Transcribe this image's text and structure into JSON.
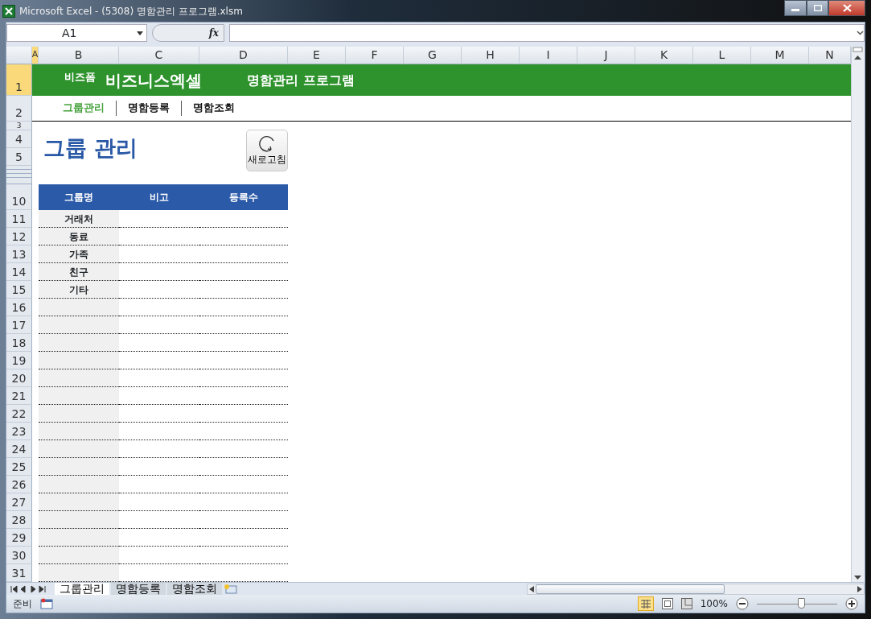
{
  "window": {
    "title": "Microsoft Excel - (5308) 명함관리 프로그램.xlsm"
  },
  "formula_bar": {
    "name_box": "A1",
    "fx": "fx"
  },
  "columns": [
    {
      "label": "A",
      "selected": true
    },
    {
      "label": "B",
      "selected": false
    },
    {
      "label": "C",
      "selected": false
    },
    {
      "label": "D",
      "selected": false
    },
    {
      "label": "E",
      "selected": false
    },
    {
      "label": "F",
      "selected": false
    },
    {
      "label": "G",
      "selected": false
    },
    {
      "label": "H",
      "selected": false
    },
    {
      "label": "I",
      "selected": false
    },
    {
      "label": "J",
      "selected": false
    },
    {
      "label": "K",
      "selected": false
    },
    {
      "label": "L",
      "selected": false
    },
    {
      "label": "M",
      "selected": false
    },
    {
      "label": "N",
      "selected": false
    }
  ],
  "row_headers": [
    {
      "label": "1",
      "selected": true
    },
    {
      "label": "2",
      "selected": false
    },
    {
      "label": "3",
      "selected": false
    },
    {
      "label": "4",
      "selected": false
    },
    {
      "label": "5",
      "selected": false
    },
    {
      "label": "10",
      "selected": false
    },
    {
      "label": "11",
      "selected": false
    },
    {
      "label": "12",
      "selected": false
    },
    {
      "label": "13",
      "selected": false
    },
    {
      "label": "14",
      "selected": false
    },
    {
      "label": "15",
      "selected": false
    },
    {
      "label": "16",
      "selected": false
    },
    {
      "label": "17",
      "selected": false
    },
    {
      "label": "18",
      "selected": false
    },
    {
      "label": "19",
      "selected": false
    },
    {
      "label": "20",
      "selected": false
    },
    {
      "label": "21",
      "selected": false
    },
    {
      "label": "22",
      "selected": false
    },
    {
      "label": "23",
      "selected": false
    },
    {
      "label": "24",
      "selected": false
    },
    {
      "label": "25",
      "selected": false
    },
    {
      "label": "26",
      "selected": false
    },
    {
      "label": "27",
      "selected": false
    },
    {
      "label": "28",
      "selected": false
    },
    {
      "label": "29",
      "selected": false
    },
    {
      "label": "30",
      "selected": false
    },
    {
      "label": "31",
      "selected": false
    }
  ],
  "banner": {
    "brand_small": "비즈폼",
    "brand": "비즈니스엑셀",
    "title": "명함관리 프로그램"
  },
  "nav": [
    {
      "label": "그룹관리",
      "selected": true
    },
    {
      "label": "명함등록",
      "selected": false
    },
    {
      "label": "명함조회",
      "selected": false
    }
  ],
  "page_title": "그룹 관리",
  "refresh_button": "새로고침",
  "table": {
    "columns": [
      "그룹명",
      "비고",
      "등록수"
    ],
    "rows": [
      {
        "group": "거래처"
      },
      {
        "group": "동료"
      },
      {
        "group": "가족"
      },
      {
        "group": "친구"
      },
      {
        "group": "기타"
      }
    ]
  },
  "sheet_tabs": [
    {
      "label": "그룹관리",
      "selected": true
    },
    {
      "label": "명함등록",
      "selected": false
    },
    {
      "label": "명함조회",
      "selected": false
    }
  ],
  "status_bar": {
    "status": "준비",
    "zoom": "100%",
    "zoom_slider": {
      "level": 0.55
    }
  }
}
